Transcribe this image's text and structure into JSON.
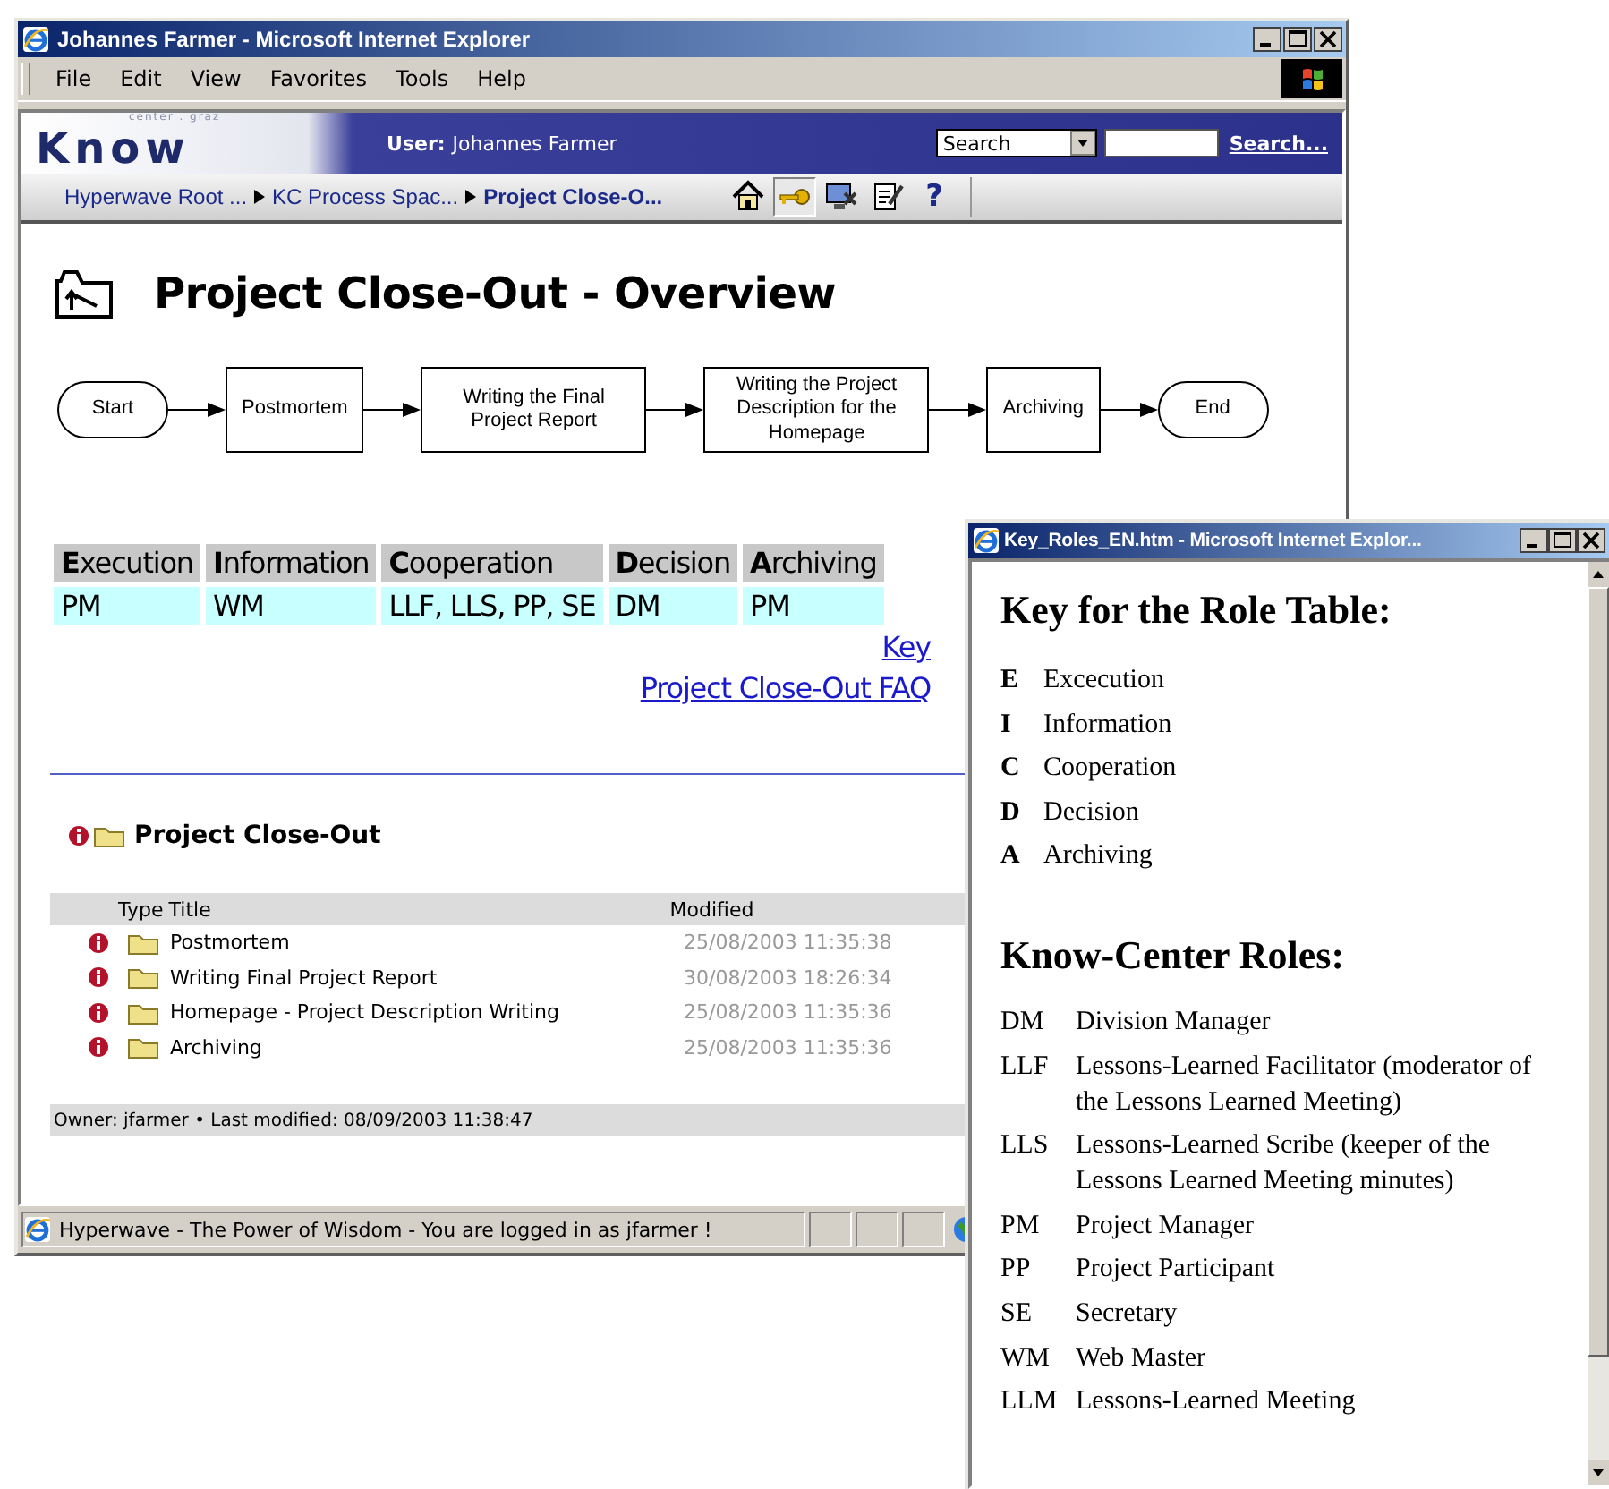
{
  "main_window": {
    "title": "Johannes Farmer - Microsoft Internet Explorer",
    "menu": [
      "File",
      "Edit",
      "View",
      "Favorites",
      "Tools",
      "Help"
    ],
    "portal": {
      "logo_text": "Know",
      "logo_subtext": "center . graz",
      "user_label": "User:",
      "user_name": "Johannes Farmer",
      "search_select": "Search",
      "search_link": "Search..."
    },
    "breadcrumbs": [
      {
        "label": "Hyperwave Root ...",
        "current": false
      },
      {
        "label": "KC Process Spac...",
        "current": false
      },
      {
        "label": "Project Close-O...",
        "current": true
      }
    ],
    "toolbar": [
      {
        "kind": "home",
        "pressed": false
      },
      {
        "kind": "key",
        "pressed": true
      },
      {
        "kind": "admin",
        "pressed": false
      },
      {
        "kind": "edit",
        "pressed": false
      },
      {
        "kind": "help",
        "label": "?",
        "pressed": false
      }
    ],
    "page_title": "Project Close-Out - Overview",
    "flow": [
      {
        "kind": "terminal",
        "label": "Start"
      },
      {
        "kind": "step",
        "label": "Postmortem"
      },
      {
        "kind": "step",
        "label": "Writing the Final Project Report"
      },
      {
        "kind": "step",
        "label": "Writing the Project Description for the Homepage"
      },
      {
        "kind": "step",
        "label": "Archiving"
      },
      {
        "kind": "terminal",
        "label": "End"
      }
    ],
    "roles_table": {
      "columns": [
        "**E**xecution",
        "**I**nformation",
        "**C**ooperation",
        "**D**ecision",
        "**A**rchiving"
      ],
      "row": [
        "PM",
        "WM",
        "LLF, LLS, PP, SE",
        "DM",
        "PM"
      ]
    },
    "links": [
      "Key",
      "Project Close-Out FAQ"
    ],
    "section_title": "Project Close-Out",
    "files": {
      "columns": [
        "Type",
        "Title",
        "Modified"
      ],
      "rows": [
        {
          "title": "Postmortem",
          "modified": "25/08/2003 11:35:38"
        },
        {
          "title": "Writing Final Project Report",
          "modified": "30/08/2003 18:26:34"
        },
        {
          "title": "Homepage - Project Description Writing",
          "modified": "25/08/2003 11:35:36"
        },
        {
          "title": "Archiving",
          "modified": "25/08/2003 11:35:36"
        }
      ]
    },
    "footer": "Owner: jfarmer • Last modified: 08/09/2003 11:38:47",
    "status_bar": "Hyperwave - The Power of Wisdom - You are logged in as jfarmer !"
  },
  "popup_window": {
    "title": "Key_Roles_EN.htm - Microsoft Internet Explor...",
    "key_heading": "Key for the Role Table:",
    "key_items": [
      {
        "letter": "E",
        "name": "Excecution"
      },
      {
        "letter": "I",
        "name": "Information"
      },
      {
        "letter": "C",
        "name": "Cooperation"
      },
      {
        "letter": "D",
        "name": "Decision"
      },
      {
        "letter": "A",
        "name": "Archiving"
      }
    ],
    "roles_heading": "Know-Center Roles:",
    "roles": [
      {
        "abbr": "DM",
        "name": "Division Manager"
      },
      {
        "abbr": "LLF",
        "name": "Lessons-Learned Facilitator (moderator of the Lessons Learned Meeting)"
      },
      {
        "abbr": "LLS",
        "name": "Lessons-Learned Scribe (keeper of the Lessons Learned Meeting minutes)"
      },
      {
        "abbr": "PM",
        "name": "Project Manager"
      },
      {
        "abbr": "PP",
        "name": "Project Participant"
      },
      {
        "abbr": "SE",
        "name": "Secretary"
      },
      {
        "abbr": "WM",
        "name": "Web Master"
      },
      {
        "abbr": "LLM",
        "name": "Lessons-Learned Meeting"
      }
    ]
  }
}
